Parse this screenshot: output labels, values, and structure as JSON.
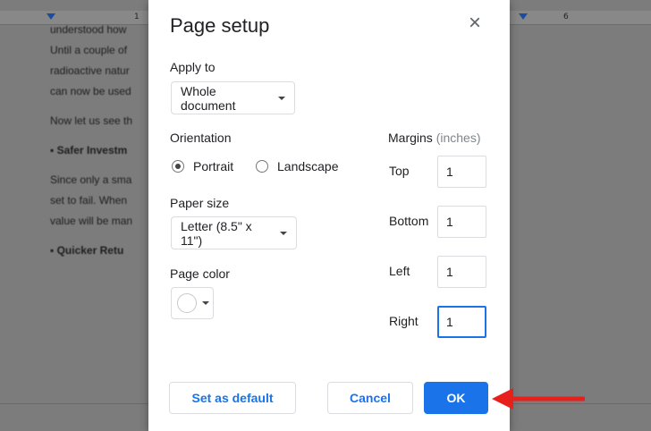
{
  "background_doc": {
    "ruler_numbers": [
      "1",
      "6"
    ],
    "lines": [
      {
        "text": "understood how",
        "bold": false
      },
      {
        "text": "Until a couple of",
        "bold": false
      },
      {
        "text": "radioactive natur",
        "bold": false
      },
      {
        "text": "can now be used",
        "bold": false
      },
      {
        "text": "Now let us see th",
        "bold": false
      },
      {
        "text": "▪   Safer Investm",
        "bold": true
      },
      {
        "text": "Since only a sma",
        "bold": false
      },
      {
        "text": "set to fail. When",
        "bold": false
      },
      {
        "text": "value will be man",
        "bold": false
      },
      {
        "text": "▪   Quicker Retu",
        "bold": true
      }
    ]
  },
  "dialog": {
    "title": "Page setup",
    "close_icon": "×",
    "apply_to": {
      "label": "Apply to",
      "value": "Whole document"
    },
    "orientation": {
      "label": "Orientation",
      "options": [
        {
          "label": "Portrait",
          "checked": true
        },
        {
          "label": "Landscape",
          "checked": false
        }
      ]
    },
    "paper_size": {
      "label": "Paper size",
      "value": "Letter (8.5\" x 11\")"
    },
    "page_color": {
      "label": "Page color",
      "value": "#ffffff"
    },
    "margins": {
      "label": "Margins",
      "unit": "(inches)",
      "fields": [
        {
          "label": "Top",
          "value": "1"
        },
        {
          "label": "Bottom",
          "value": "1"
        },
        {
          "label": "Left",
          "value": "1"
        },
        {
          "label": "Right",
          "value": "1"
        }
      ]
    },
    "buttons": {
      "set_default": "Set as default",
      "cancel": "Cancel",
      "ok": "OK"
    }
  },
  "annotation": {
    "arrow_color": "#e8201c",
    "arrow_target": "OK"
  }
}
